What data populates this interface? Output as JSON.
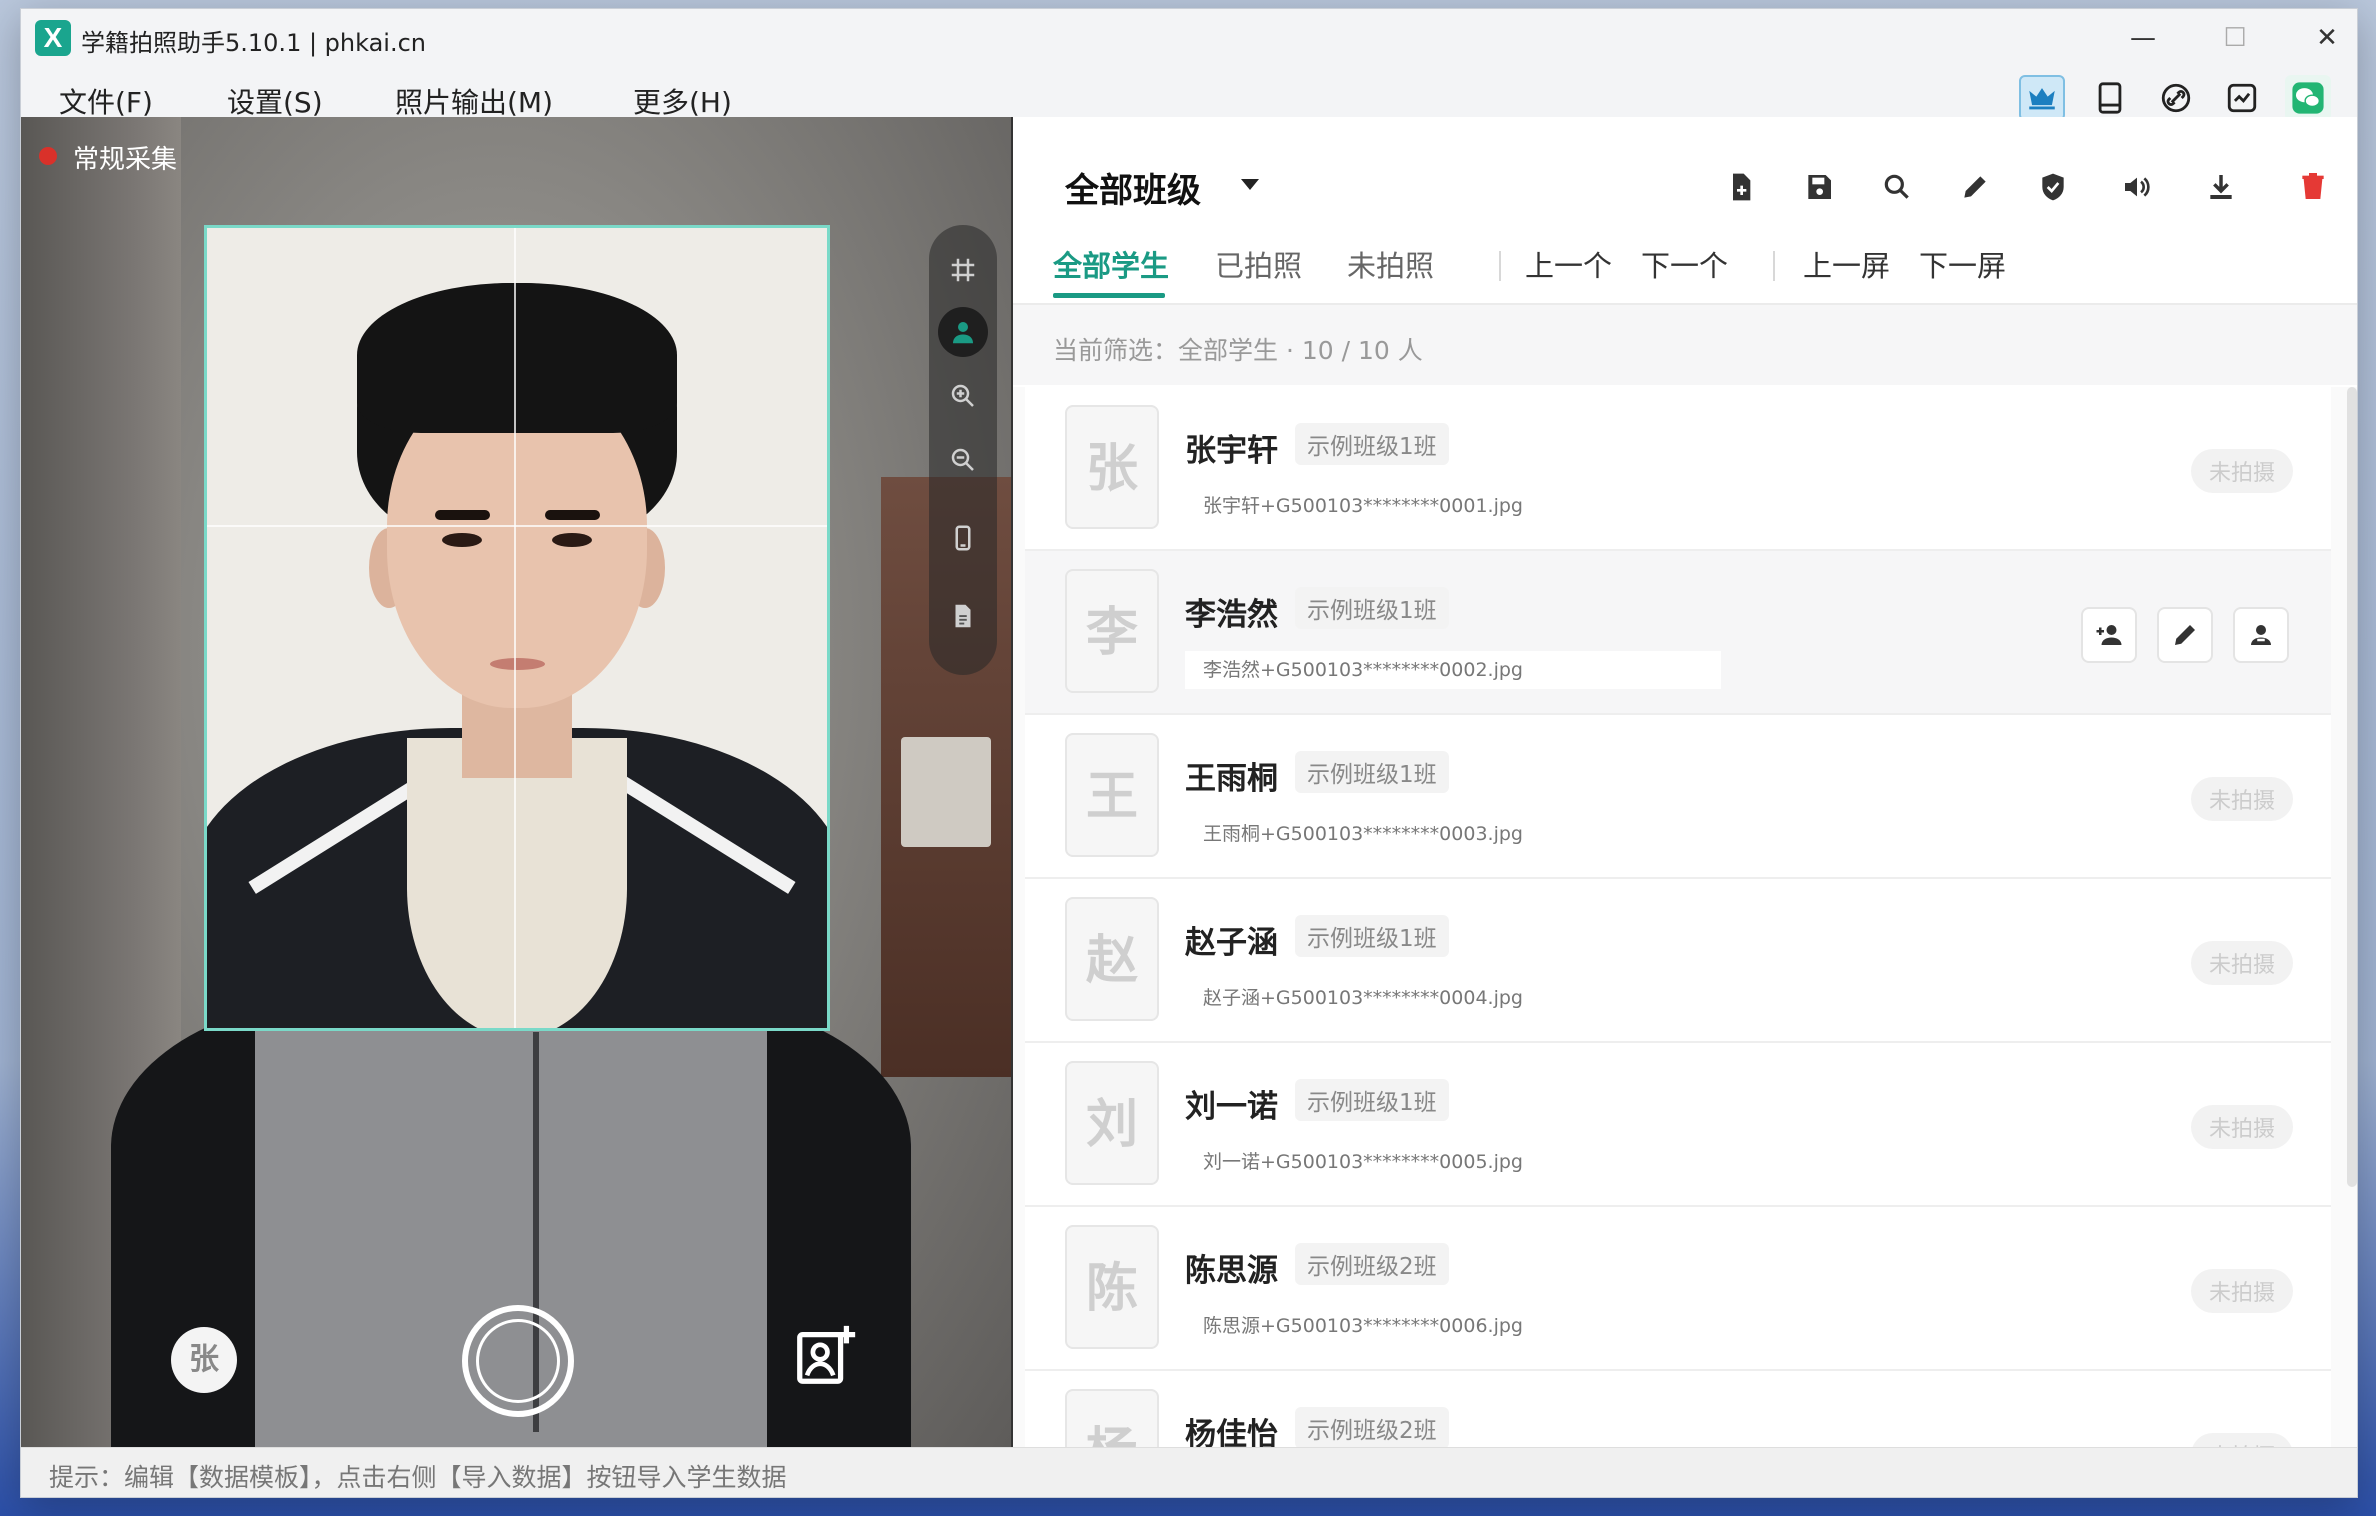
{
  "window": {
    "title": "学籍拍照助手5.10.1 | phkai.cn",
    "logo": "X",
    "controls": {
      "minimize": "—",
      "maximize": "☐",
      "close": "✕"
    }
  },
  "menu": {
    "items": [
      "文件(F)",
      "设置(S)",
      "照片输出(M)",
      "更多(H)"
    ],
    "toolbar_icons": [
      "crown-icon",
      "tablet-icon",
      "link-icon",
      "swap-icon",
      "wechat-icon"
    ]
  },
  "camera": {
    "mode_label": "常规采集",
    "current_avatar_char": "张",
    "tools": [
      "grid-icon",
      "person-icon",
      "zoom-in-icon",
      "zoom-out-icon",
      "phone-icon",
      "document-icon"
    ],
    "active_tool": "person-icon"
  },
  "panel": {
    "class_select": "全部班级",
    "tools": [
      "add-file-icon",
      "save-icon",
      "search-icon",
      "edit-icon",
      "shield-icon",
      "volume-icon",
      "download-icon",
      "delete-icon"
    ],
    "tabs": [
      {
        "label": "全部学生",
        "active": true
      },
      {
        "label": "已拍照",
        "active": false
      },
      {
        "label": "未拍照",
        "active": false
      }
    ],
    "nav": [
      "上一个",
      "下一个",
      "上一屏",
      "下一屏"
    ],
    "filter_text": "当前筛选：全部学生 · 10 / 10 人",
    "colors": {
      "accent": "#1a9a84",
      "danger": "#e53935"
    }
  },
  "students": [
    {
      "initial": "张",
      "name": "张宇轩",
      "class": "示例班级1班",
      "file": "张宇轩+G500103********0001.jpg",
      "status": "未拍摄"
    },
    {
      "initial": "李",
      "name": "李浩然",
      "class": "示例班级1班",
      "file": "李浩然+G500103********0002.jpg",
      "status": ""
    },
    {
      "initial": "王",
      "name": "王雨桐",
      "class": "示例班级1班",
      "file": "王雨桐+G500103********0003.jpg",
      "status": "未拍摄"
    },
    {
      "initial": "赵",
      "name": "赵子涵",
      "class": "示例班级1班",
      "file": "赵子涵+G500103********0004.jpg",
      "status": "未拍摄"
    },
    {
      "initial": "刘",
      "name": "刘一诺",
      "class": "示例班级1班",
      "file": "刘一诺+G500103********0005.jpg",
      "status": "未拍摄"
    },
    {
      "initial": "陈",
      "name": "陈思源",
      "class": "示例班级2班",
      "file": "陈思源+G500103********0006.jpg",
      "status": "未拍摄"
    },
    {
      "initial": "杨",
      "name": "杨佳怡",
      "class": "示例班级2班",
      "file": "",
      "status": "未拍摄"
    }
  ],
  "status_bar": "提示：编辑【数据模板】，点击右侧【导入数据】按钮导入学生数据"
}
